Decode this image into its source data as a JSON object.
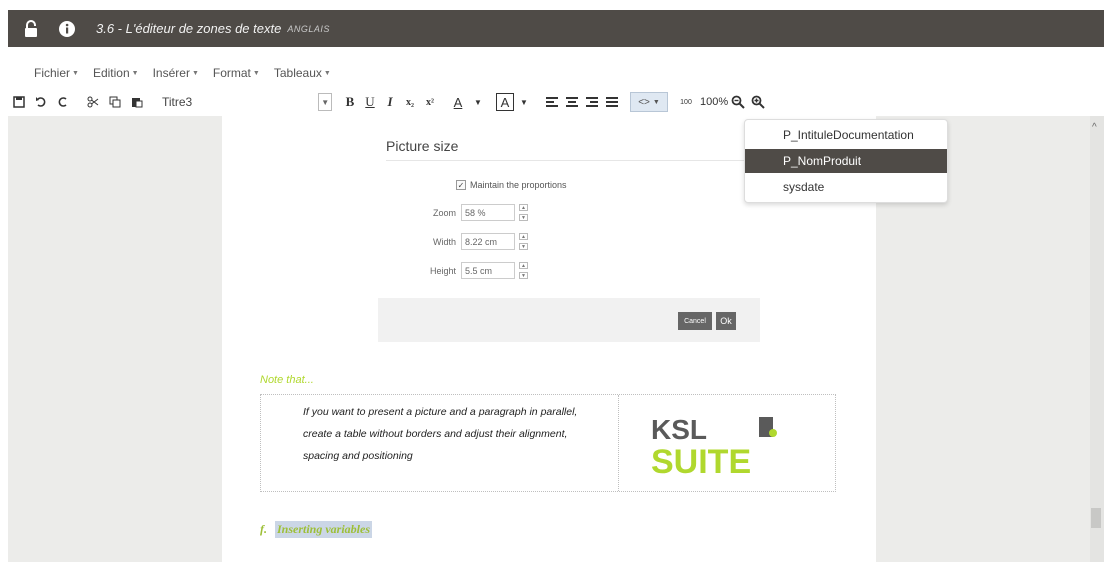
{
  "titlebar": {
    "title": "3.6 - L'éditeur de zones de texte",
    "subtitle": "ANGLAIS",
    "lock_icon": "lock-icon",
    "info_icon": "info-icon"
  },
  "menubar": {
    "items": [
      {
        "label": "Fichier"
      },
      {
        "label": "Edition"
      },
      {
        "label": "Insérer"
      },
      {
        "label": "Format"
      },
      {
        "label": "Tableaux"
      }
    ]
  },
  "toolbar": {
    "style_value": "Titre3",
    "bold": "B",
    "underline": "U",
    "italic": "I",
    "subscript": "x₂",
    "superscript": "x²",
    "font_color": "A",
    "bg_color": "A",
    "variables": "<>",
    "zoom_level": "100%",
    "hundred_icon": "100"
  },
  "dialog": {
    "title": "Picture size",
    "maintain_proportions": "Maintain the proportions",
    "zoom_label": "Zoom",
    "zoom_value": "58 %",
    "width_label": "Width",
    "width_value": "8.22 cm",
    "height_label": "Height",
    "height_value": "5.5 cm",
    "cancel": "Cancel",
    "ok": "Ok"
  },
  "note": {
    "title": "Note that...",
    "line1": "If you want to present a picture and a paragraph in parallel,",
    "line2": "create a table without borders and adjust their alignment,",
    "line3": "spacing and positioning",
    "logo_line1": "KSL",
    "logo_line2": "SUITE"
  },
  "section": {
    "number": "f.",
    "title": "Inserting variables"
  },
  "variables_dropdown": {
    "items": [
      {
        "label": "P_IntituleDocumentation"
      },
      {
        "label": "P_NomProduit"
      },
      {
        "label": "sysdate"
      }
    ],
    "selected": "P_NomProduit"
  },
  "colors": {
    "titlebar_bg": "#4f4b47",
    "accent_green": "#b0d82e",
    "workspace_bg": "#ececea"
  }
}
